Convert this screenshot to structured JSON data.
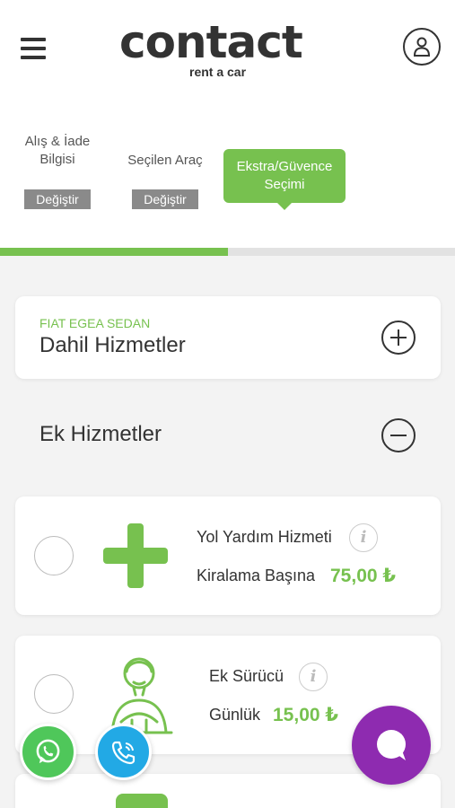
{
  "header": {
    "logo_text": "contact",
    "logo_sub": "rent a car",
    "menu_icon": "hamburger-menu-icon",
    "account_icon": "user-icon"
  },
  "steps": [
    {
      "label": "Alış & İade Bilgisi",
      "action": "Değiştir",
      "state": "done"
    },
    {
      "label": "Seçilen Araç",
      "action": "Değiştir",
      "state": "done"
    },
    {
      "label": "Ekstra/Güvence Seçimi",
      "state": "active"
    }
  ],
  "progress": {
    "fraction": 0.5
  },
  "included": {
    "car_name": "FIAT EGEA SEDAN",
    "title": "Dahil Hizmetler",
    "toggle_icon": "plus-circle-icon"
  },
  "extras": {
    "title": "Ek Hizmetler",
    "toggle_icon": "minus-circle-icon",
    "items": [
      {
        "name": "Yol Yardım Hizmeti",
        "period": "Kiralama Başına",
        "price": "75,00 ₺",
        "icon": "plus-icon"
      },
      {
        "name": "Ek Sürücü",
        "period": "Günlük",
        "price": "15,00 ₺",
        "icon": "driver-icon"
      }
    ]
  },
  "floating": {
    "whatsapp_icon": "whatsapp-icon",
    "call_icon": "phone-call-icon",
    "chat_icon": "chat-bubble-icon"
  },
  "colors": {
    "accent_green": "#77c14f",
    "whatsapp_green": "#4fc75a",
    "call_blue": "#22a9e5",
    "chat_purple": "#8e2bb0",
    "button_gray": "#8a8a8a"
  }
}
